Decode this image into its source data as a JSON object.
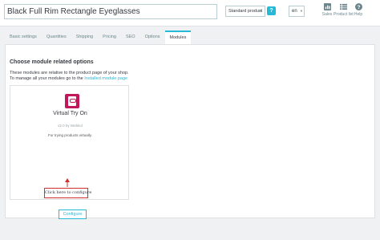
{
  "header": {
    "product_name": "Black Full Rim Rectangle Eyeglasses",
    "product_type": "Standard product",
    "help": "?",
    "language": "en",
    "buttons": [
      {
        "label": "Sales",
        "icon": "bar-chart-icon"
      },
      {
        "label": "Product list",
        "icon": "list-icon"
      },
      {
        "label": "Help",
        "icon": "help-icon"
      }
    ]
  },
  "tabs": [
    "Basic settings",
    "Quantities",
    "Shipping",
    "Pricing",
    "SEO",
    "Options",
    "Modules"
  ],
  "active_tab": "Modules",
  "panel": {
    "title": "Choose module related options",
    "desc_line1": "These modules are relative to the product page of your shop.",
    "desc_line2_prefix": "To manage all your modules go to the",
    "desc_line2_link": "Installed module page"
  },
  "module": {
    "name": "Virtual Try On",
    "version": "v2.0 by Webkul",
    "description": "For trying products virtually.",
    "configure_label": "Configure"
  },
  "annotation": "Click here to configure",
  "colors": {
    "accent": "#25b9d7",
    "module_logo": "#c2185b",
    "annotation": "#d32f2f"
  }
}
